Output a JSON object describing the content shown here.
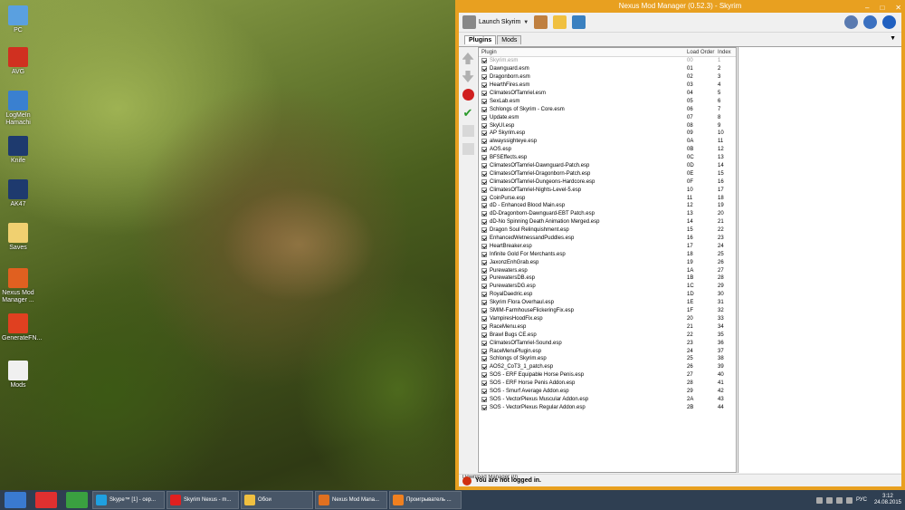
{
  "desktop": {
    "icons": [
      {
        "label": "PC",
        "icon": "pc-icon",
        "color": "#5aa0e0"
      },
      {
        "label": "AVG",
        "icon": "avg-icon",
        "color": "#d03020"
      },
      {
        "label": "LogMeIn Hamachi",
        "icon": "hamachi-icon",
        "color": "#3a80d0"
      },
      {
        "label": "Knife",
        "icon": "photoshop-icon",
        "color": "#1e3a6e"
      },
      {
        "label": "AK47",
        "icon": "photoshop-icon",
        "color": "#1e3a6e"
      },
      {
        "label": "Saves",
        "icon": "folder-icon",
        "color": "#f0d070"
      },
      {
        "label": "Nexus Mod Manager ...",
        "icon": "nmm-icon",
        "color": "#e06020"
      },
      {
        "label": "GenerateFN...",
        "icon": "generate-icon",
        "color": "#e04020"
      },
      {
        "label": "Mods",
        "icon": "folder-icon",
        "color": "#f0f0f0"
      }
    ]
  },
  "window": {
    "title": "Nexus Mod Manager (0.52.3) - Skyrim",
    "title_color": "#e8a020",
    "controls": [
      "–",
      "□",
      "✕"
    ],
    "toolbar": {
      "launch_label": "Launch Skyrim"
    },
    "tabs": [
      "Plugins",
      "Mods"
    ],
    "tab_arrow": "▼",
    "columns": {
      "plugin": "Plugin",
      "order": "Load Order",
      "index": "Index"
    },
    "plugins": [
      {
        "name": "Skyrim.esm",
        "order": "00",
        "index": "1",
        "dim": true
      },
      {
        "name": "Dawnguard.esm",
        "order": "01",
        "index": "2"
      },
      {
        "name": "Dragonborn.esm",
        "order": "02",
        "index": "3"
      },
      {
        "name": "HearthFires.esm",
        "order": "03",
        "index": "4"
      },
      {
        "name": "ClimatesOfTamriel.esm",
        "order": "04",
        "index": "5"
      },
      {
        "name": "SexLab.esm",
        "order": "05",
        "index": "6"
      },
      {
        "name": "Schlongs of Skyrim - Core.esm",
        "order": "06",
        "index": "7"
      },
      {
        "name": "Update.esm",
        "order": "07",
        "index": "8"
      },
      {
        "name": "SkyUI.esp",
        "order": "08",
        "index": "9"
      },
      {
        "name": "AP Skyrim.esp",
        "order": "09",
        "index": "10"
      },
      {
        "name": "alwayssighteye.esp",
        "order": "0A",
        "index": "11"
      },
      {
        "name": "AOS.esp",
        "order": "0B",
        "index": "12"
      },
      {
        "name": "BFSEffects.esp",
        "order": "0C",
        "index": "13"
      },
      {
        "name": "ClimatesOfTamriel-Dawnguard-Patch.esp",
        "order": "0D",
        "index": "14"
      },
      {
        "name": "ClimatesOfTamriel-Dragonborn-Patch.esp",
        "order": "0E",
        "index": "15"
      },
      {
        "name": "ClimatesOfTamriel-Dungeons-Hardcore.esp",
        "order": "0F",
        "index": "16"
      },
      {
        "name": "ClimatesOfTamriel-Nights-Level-5.esp",
        "order": "10",
        "index": "17"
      },
      {
        "name": "CoinPurse.esp",
        "order": "11",
        "index": "18"
      },
      {
        "name": "dD - Enhanced Blood Main.esp",
        "order": "12",
        "index": "19"
      },
      {
        "name": "dD-Dragonborn-Dawnguard-EBT Patch.esp",
        "order": "13",
        "index": "20"
      },
      {
        "name": "dD-No Spinning Death Animation Merged.esp",
        "order": "14",
        "index": "21"
      },
      {
        "name": "Dragon Soul Relinquishment.esp",
        "order": "15",
        "index": "22"
      },
      {
        "name": "EnhancedWetnessandPuddles.esp",
        "order": "16",
        "index": "23"
      },
      {
        "name": "HeartBreaker.esp",
        "order": "17",
        "index": "24"
      },
      {
        "name": "Infinite Gold For Merchants.esp",
        "order": "18",
        "index": "25"
      },
      {
        "name": "JaxonzEnhGrab.esp",
        "order": "19",
        "index": "26"
      },
      {
        "name": "Purewaters.esp",
        "order": "1A",
        "index": "27"
      },
      {
        "name": "PurewatersDB.esp",
        "order": "1B",
        "index": "28"
      },
      {
        "name": "PurewatersDG.esp",
        "order": "1C",
        "index": "29"
      },
      {
        "name": "RoyalDaedric.esp",
        "order": "1D",
        "index": "30"
      },
      {
        "name": "Skyrim Flora Overhaul.esp",
        "order": "1E",
        "index": "31"
      },
      {
        "name": "SMIM-FarmhouseFlickeringFix.esp",
        "order": "1F",
        "index": "32"
      },
      {
        "name": "VampiresHoodFix.esp",
        "order": "20",
        "index": "33"
      },
      {
        "name": "RaceMenu.esp",
        "order": "21",
        "index": "34"
      },
      {
        "name": "Brawl Bugs CE.esp",
        "order": "22",
        "index": "35"
      },
      {
        "name": "ClimatesOfTamriel-Sound.esp",
        "order": "23",
        "index": "36"
      },
      {
        "name": "RaceMenuPlugin.esp",
        "order": "24",
        "index": "37"
      },
      {
        "name": "Schlongs of Skyrim.esp",
        "order": "25",
        "index": "38"
      },
      {
        "name": "AOS2_CoT3_1_patch.esp",
        "order": "26",
        "index": "39"
      },
      {
        "name": "SOS - ERF Equipable Horse Penis.esp",
        "order": "27",
        "index": "40"
      },
      {
        "name": "SOS - ERF Horse Penis Addon.esp",
        "order": "28",
        "index": "41"
      },
      {
        "name": "SOS - Smurf Average Addon.esp",
        "order": "29",
        "index": "42"
      },
      {
        "name": "SOS - VectorPlexus Muscular Addon.esp",
        "order": "2A",
        "index": "43"
      },
      {
        "name": "SOS - VectorPlexus Regular Addon.esp",
        "order": "2B",
        "index": "44"
      }
    ],
    "download_manager": "Download Manager (0)",
    "status": "You are not logged in."
  },
  "taskbar": {
    "tasks": [
      {
        "label": "Skype™ [1] - сер...",
        "icon": "skype-icon",
        "color": "#1fa0e0"
      },
      {
        "label": "Skyrim Nexus - m...",
        "icon": "yandex-icon",
        "color": "#e02020"
      },
      {
        "label": "Обои",
        "icon": "folder-icon",
        "color": "#f0c040"
      },
      {
        "label": "Nexus Mod Mana...",
        "icon": "nmm-icon",
        "color": "#e07020"
      },
      {
        "label": "Проигрыватель ...",
        "icon": "player-icon",
        "color": "#f08020"
      }
    ],
    "lang": "РУС",
    "time": "3:12",
    "date": "24.08.2015"
  }
}
